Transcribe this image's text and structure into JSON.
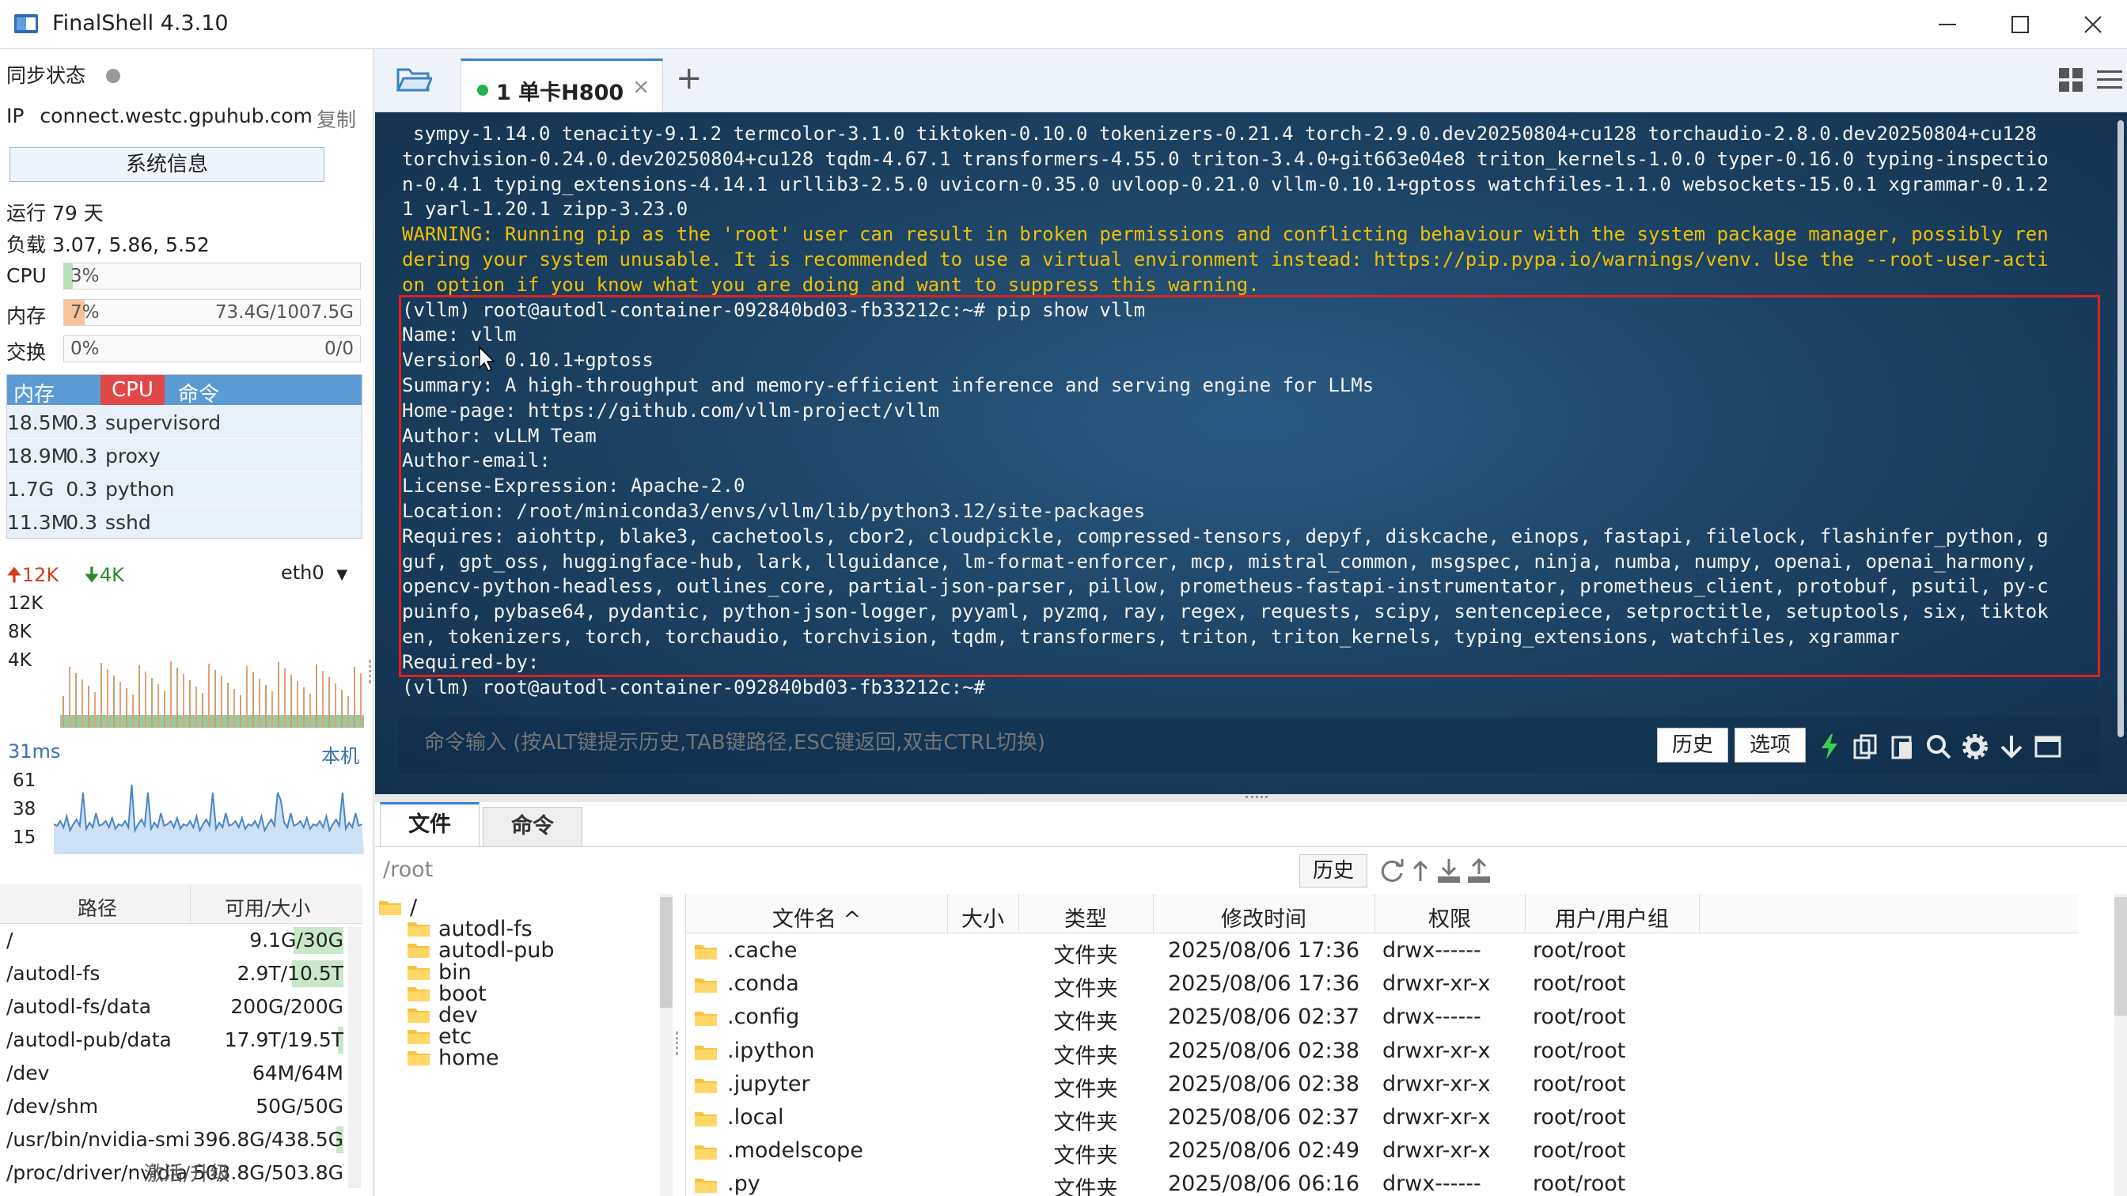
{
  "window": {
    "title": "FinalShell 4.3.10"
  },
  "left": {
    "sync_label": "同步状态",
    "ip_label": "IP",
    "host": "connect.westc.gpuhub.com",
    "copy_label": "复制",
    "sysinfo_button": "系统信息",
    "uptime": "运行 79 天",
    "load": "负载 3.07, 5.86, 5.52",
    "cpu": {
      "label": "CPU",
      "pct": "3%",
      "fraction": 0.03,
      "value": ""
    },
    "mem": {
      "label": "内存",
      "pct": "7%",
      "fraction": 0.07,
      "value": "73.4G/1007.5G"
    },
    "swap": {
      "label": "交换",
      "pct": "0%",
      "fraction": 0.0,
      "value": "0/0"
    },
    "proc_headers": [
      "内存",
      "CPU",
      "命令"
    ],
    "processes": [
      {
        "mem": "18.5M",
        "cpu": "0.3",
        "cmd": "supervisord"
      },
      {
        "mem": "18.9M",
        "cpu": "0.3",
        "cmd": "proxy"
      },
      {
        "mem": "1.7G",
        "cpu": "0.3",
        "cmd": "python"
      },
      {
        "mem": "11.3M",
        "cpu": "0.3",
        "cmd": "sshd"
      }
    ],
    "net": {
      "up": "12K",
      "down": "4K",
      "iface": "eth0",
      "ticks": [
        "12K",
        "8K",
        "4K"
      ]
    },
    "ping": {
      "ms": "31ms",
      "host_label": "本机",
      "ticks": [
        "61",
        "38",
        "15"
      ]
    },
    "disk_headers": [
      "路径",
      "可用/大小"
    ],
    "disks": [
      {
        "path": "/",
        "size": "9.1G/30G",
        "used_fraction": 0.7
      },
      {
        "path": "/autodl-fs",
        "size": "2.9T/10.5T",
        "used_fraction": 0.72
      },
      {
        "path": "/autodl-fs/data",
        "size": "200G/200G",
        "used_fraction": 0.0
      },
      {
        "path": "/autodl-pub/data",
        "size": "17.9T/19.5T",
        "used_fraction": 0.08
      },
      {
        "path": "/dev",
        "size": "64M/64M",
        "used_fraction": 0.0
      },
      {
        "path": "/dev/shm",
        "size": "50G/50G",
        "used_fraction": 0.0
      },
      {
        "path": "/usr/bin/nvidia-smi",
        "size": "396.8G/438.5G",
        "used_fraction": 0.1
      },
      {
        "path": "/proc/driver/nvidia",
        "size": "503.8G/503.8G",
        "used_fraction": 0.0
      }
    ],
    "activate": "激活/升级"
  },
  "tabs": [
    {
      "label": "1 单卡H800",
      "close": "×"
    }
  ],
  "add_tab": "+",
  "terminal": {
    "lines": [
      {
        "t": "sympy-1.14.0 tenacity-9.1.2 termcolor-3.1.0 tiktoken-0.10.0 tokenizers-0.21.4 torch-2.9.0.dev20250804+cu128 torchaudio-2.8.0.dev20250804+cu128",
        "warn": false,
        "indent": true
      },
      {
        "t": "torchvision-0.24.0.dev20250804+cu128 tqdm-4.67.1 transformers-4.55.0 triton-3.4.0+git663e04e8 triton_kernels-1.0.0 typer-0.16.0 typing-inspectio",
        "warn": false
      },
      {
        "t": "n-0.4.1 typing_extensions-4.14.1 urllib3-2.5.0 uvicorn-0.35.0 uvloop-0.21.0 vllm-0.10.1+gptoss watchfiles-1.1.0 websockets-15.0.1 xgrammar-0.1.2",
        "warn": false
      },
      {
        "t": "1 yarl-1.20.1 zipp-3.23.0",
        "warn": false
      },
      {
        "t": "WARNING: Running pip as the 'root' user can result in broken permissions and conflicting behaviour with the system package manager, possibly ren",
        "warn": true
      },
      {
        "t": "dering your system unusable. It is recommended to use a virtual environment instead: https://pip.pypa.io/warnings/venv. Use the --root-user-acti",
        "warn": true
      },
      {
        "t": "on option if you know what you are doing and want to suppress this warning.",
        "warn": true
      },
      {
        "t": "(vllm) root@autodl-container-092840bd03-fb33212c:~# pip show vllm",
        "warn": false
      },
      {
        "t": "Name: vllm",
        "warn": false
      },
      {
        "t": "Version: 0.10.1+gptoss",
        "warn": false
      },
      {
        "t": "Summary: A high-throughput and memory-efficient inference and serving engine for LLMs",
        "warn": false
      },
      {
        "t": "Home-page: https://github.com/vllm-project/vllm",
        "warn": false
      },
      {
        "t": "Author: vLLM Team",
        "warn": false
      },
      {
        "t": "Author-email:",
        "warn": false
      },
      {
        "t": "License-Expression: Apache-2.0",
        "warn": false
      },
      {
        "t": "Location: /root/miniconda3/envs/vllm/lib/python3.12/site-packages",
        "warn": false
      },
      {
        "t": "Requires: aiohttp, blake3, cachetools, cbor2, cloudpickle, compressed-tensors, depyf, diskcache, einops, fastapi, filelock, flashinfer_python, g",
        "warn": false
      },
      {
        "t": "guf, gpt_oss, huggingface-hub, lark, llguidance, lm-format-enforcer, mcp, mistral_common, msgspec, ninja, numba, numpy, openai, openai_harmony,",
        "warn": false
      },
      {
        "t": "opencv-python-headless, outlines_core, partial-json-parser, pillow, prometheus-fastapi-instrumentator, prometheus_client, protobuf, psutil, py-c",
        "warn": false
      },
      {
        "t": "puinfo, pybase64, pydantic, python-json-logger, pyyaml, pyzmq, ray, regex, requests, scipy, sentencepiece, setproctitle, setuptools, six, tiktok",
        "warn": false
      },
      {
        "t": "en, tokenizers, torch, torchaudio, torchvision, tqdm, transformers, triton, triton_kernels, typing_extensions, watchfiles, xgrammar",
        "warn": false
      },
      {
        "t": "Required-by:",
        "warn": false
      },
      {
        "t": "(vllm) root@autodl-container-092840bd03-fb33212c:~#",
        "warn": false
      }
    ],
    "cmd_placeholder": "命令输入 (按ALT键提示历史,TAB键路径,ESC键返回,双击CTRL切换)",
    "history_button": "历史",
    "options_button": "选项"
  },
  "files": {
    "tab_files": "文件",
    "tab_commands": "命令",
    "path": "/root",
    "history_button": "历史",
    "tree": [
      {
        "name": "/",
        "level": 0
      },
      {
        "name": "autodl-fs",
        "level": 1
      },
      {
        "name": "autodl-pub",
        "level": 1
      },
      {
        "name": "bin",
        "level": 1
      },
      {
        "name": "boot",
        "level": 1
      },
      {
        "name": "dev",
        "level": 1
      },
      {
        "name": "etc",
        "level": 1
      },
      {
        "name": "home",
        "level": 1
      }
    ],
    "columns": [
      "文件名 ^",
      "大小",
      "类型",
      "修改时间",
      "权限",
      "用户/用户组"
    ],
    "rows": [
      {
        "name": ".cache",
        "size": "",
        "type": "文件夹",
        "mtime": "2025/08/06 17:36",
        "perm": "drwx------",
        "owner": "root/root"
      },
      {
        "name": ".conda",
        "size": "",
        "type": "文件夹",
        "mtime": "2025/08/06 17:36",
        "perm": "drwxr-xr-x",
        "owner": "root/root"
      },
      {
        "name": ".config",
        "size": "",
        "type": "文件夹",
        "mtime": "2025/08/06 02:37",
        "perm": "drwx------",
        "owner": "root/root"
      },
      {
        "name": ".ipython",
        "size": "",
        "type": "文件夹",
        "mtime": "2025/08/06 02:38",
        "perm": "drwxr-xr-x",
        "owner": "root/root"
      },
      {
        "name": ".jupyter",
        "size": "",
        "type": "文件夹",
        "mtime": "2025/08/06 02:38",
        "perm": "drwxr-xr-x",
        "owner": "root/root"
      },
      {
        "name": ".local",
        "size": "",
        "type": "文件夹",
        "mtime": "2025/08/06 02:37",
        "perm": "drwxr-xr-x",
        "owner": "root/root"
      },
      {
        "name": ".modelscope",
        "size": "",
        "type": "文件夹",
        "mtime": "2025/08/06 02:49",
        "perm": "drwxr-xr-x",
        "owner": "root/root"
      },
      {
        "name": ".py",
        "size": "",
        "type": "文件夹",
        "mtime": "2025/08/06 06:16",
        "perm": "drwx------",
        "owner": "root/root"
      }
    ]
  },
  "colors": {
    "accent": "#3b82c4",
    "warning_text": "#f0c000",
    "highlight_box": "#e02020",
    "terminal_bg": "#1c4466",
    "status_green": "#22b14c"
  }
}
